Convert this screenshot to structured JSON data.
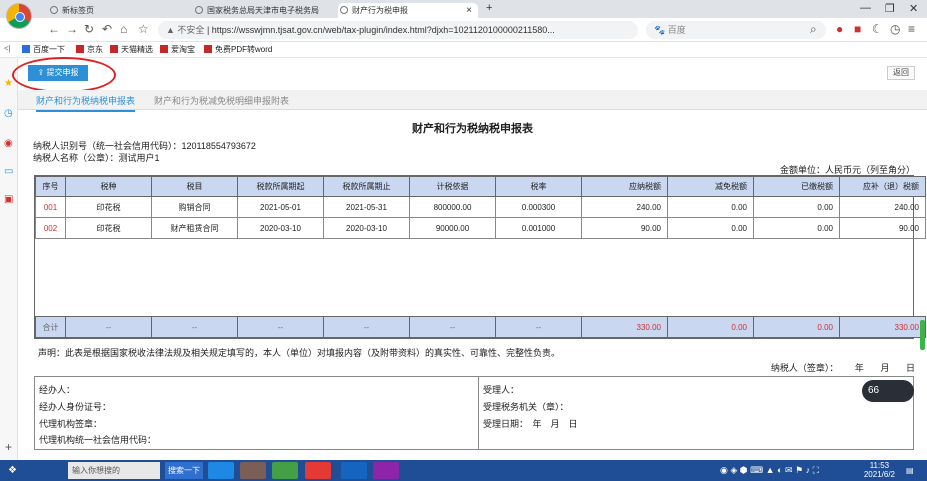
{
  "browser": {
    "tabs": [
      {
        "label": "新标签页"
      },
      {
        "label": "国家税务总局天津市电子税务局"
      },
      {
        "label": "财产行为税申报"
      }
    ],
    "tab_close": "×",
    "new_tab": "+",
    "address": {
      "security": "不安全",
      "url": "https://wsswjmn.tjsat.gov.cn/web/tax-plugin/index.html?djxh=10211201000002115​80..."
    },
    "search_placeholder": "百度",
    "bookmarks": [
      "百度一下",
      "京东",
      "天猫精选",
      "爱淘宝",
      "免费PDF转word"
    ]
  },
  "toolbar": {
    "submit_label": "提交申报",
    "back_label": "返回"
  },
  "subtabs": [
    "财产和行为税纳税申报表",
    "财产和行为税减免税明细申报附表"
  ],
  "form": {
    "title": "财产和行为税纳税申报表",
    "taxpayer_id": "纳税人识别号（统一社会信用代码）：120118554793672",
    "taxpayer_name": "纳税人名称（公章）：测试用户1",
    "unit": "金额单位：人民币元（列至角分）",
    "headers": [
      "序号",
      "税种",
      "税目",
      "税款所属期起",
      "税款所属期止",
      "计税依据",
      "税率",
      "应纳税额",
      "减免税额",
      "已缴税额",
      "应补（退）税额"
    ],
    "rows": [
      [
        "001",
        "印花税",
        "购销合同",
        "2021-05-01",
        "2021-05-31",
        "800000.00",
        "0.000300",
        "240.00",
        "0.00",
        "0.00",
        "240.00"
      ],
      [
        "002",
        "印花税",
        "财产租赁合同",
        "2020-03-10",
        "2020-03-10",
        "90000.00",
        "0.001000",
        "90.00",
        "0.00",
        "0.00",
        "90.00"
      ]
    ],
    "total": [
      "合计",
      "--",
      "--",
      "--",
      "--",
      "--",
      "--",
      "330.00",
      "0.00",
      "0.00",
      "330.00"
    ],
    "declaration": "声明：此表是根据国家税收法律法规及相关规定填写的，本人（单位）对填报内容（及附带资料）的真实性、可靠性、完整性负责。",
    "sign_label": "纳税人（签章）：",
    "year": "年",
    "month": "月",
    "day": "日",
    "agent_lines": [
      "经办人：",
      "经办人身份证号：",
      "代理机构签章：",
      "代理机构统一社会信用代码："
    ],
    "receiver_lines": [
      "受理人：",
      "受理税务机关（章）：",
      "受理日期：　年　月　日"
    ]
  },
  "widget": {
    "speed": "66"
  },
  "taskbar": {
    "search": "搜索一下",
    "input_hint": "输入你想搜的",
    "time": "11:53",
    "date": "2021/6/2"
  }
}
